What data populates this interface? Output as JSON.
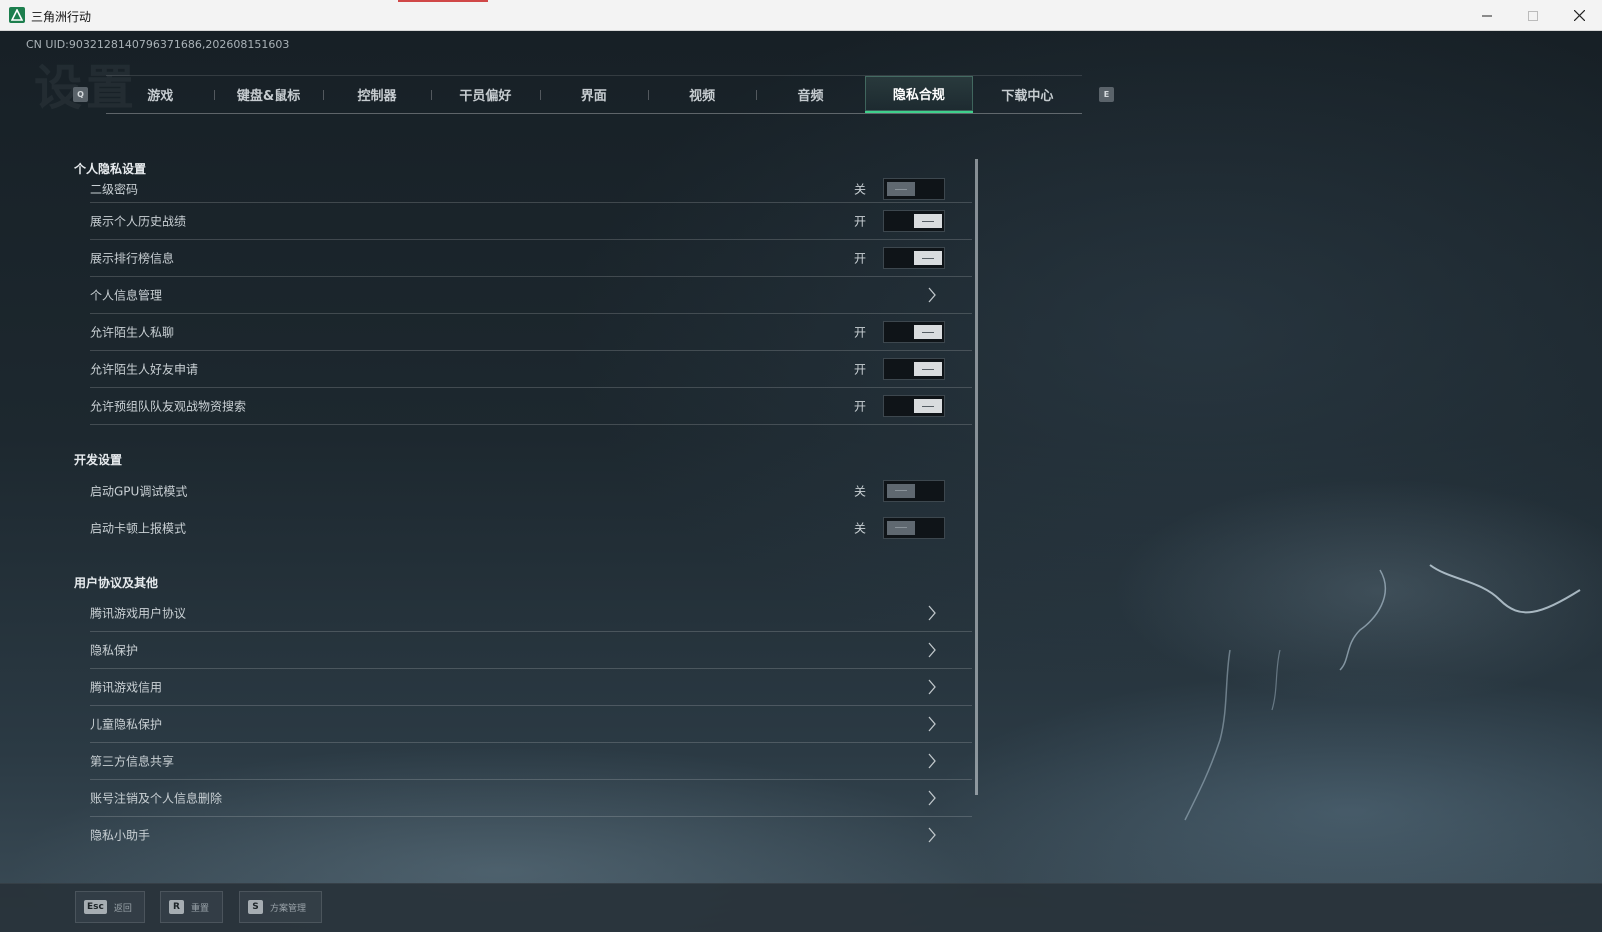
{
  "window": {
    "title": "三角洲行动"
  },
  "uid": "CN UID:9032128140796371686,202608151603",
  "watermark": "设置",
  "tabs": {
    "prev_key": "Q",
    "next_key": "E",
    "items": [
      {
        "label": "游戏",
        "active": false
      },
      {
        "label": "键盘&鼠标",
        "active": false
      },
      {
        "label": "控制器",
        "active": false
      },
      {
        "label": "干员偏好",
        "active": false
      },
      {
        "label": "界面",
        "active": false
      },
      {
        "label": "视频",
        "active": false
      },
      {
        "label": "音频",
        "active": false
      },
      {
        "label": "隐私合规",
        "active": true
      },
      {
        "label": "下载中心",
        "active": false
      }
    ]
  },
  "sections": {
    "privacy": {
      "title": "个人隐私设置",
      "rows": [
        {
          "label": "二级密码",
          "state": "关",
          "type": "toggle",
          "on": false
        },
        {
          "label": "展示个人历史战绩",
          "state": "开",
          "type": "toggle",
          "on": true
        },
        {
          "label": "展示排行榜信息",
          "state": "开",
          "type": "toggle",
          "on": true
        },
        {
          "label": "个人信息管理",
          "type": "link"
        },
        {
          "label": "允许陌生人私聊",
          "state": "开",
          "type": "toggle",
          "on": true
        },
        {
          "label": "允许陌生人好友申请",
          "state": "开",
          "type": "toggle",
          "on": true
        },
        {
          "label": "允许预组队队友观战物资搜索",
          "state": "开",
          "type": "toggle",
          "on": true
        }
      ]
    },
    "dev": {
      "title": "开发设置",
      "rows": [
        {
          "label": "启动GPU调试模式",
          "state": "关",
          "type": "toggle",
          "on": false
        },
        {
          "label": "启动卡顿上报模式",
          "state": "关",
          "type": "toggle",
          "on": false
        }
      ]
    },
    "agreements": {
      "title": "用户协议及其他",
      "rows": [
        {
          "label": "腾讯游戏用户协议",
          "type": "link"
        },
        {
          "label": "隐私保护",
          "type": "link"
        },
        {
          "label": "腾讯游戏信用",
          "type": "link"
        },
        {
          "label": "儿童隐私保护",
          "type": "link"
        },
        {
          "label": "第三方信息共享",
          "type": "link"
        },
        {
          "label": "账号注销及个人信息删除",
          "type": "link"
        },
        {
          "label": "隐私小助手",
          "type": "link"
        }
      ]
    }
  },
  "bottom": {
    "back": {
      "key": "Esc",
      "label": "返回"
    },
    "reset": {
      "key": "R",
      "label": "重置"
    },
    "scheme": {
      "key": "S",
      "label": "方案管理"
    }
  },
  "colors": {
    "accent": "#3fd08c",
    "app_icon": "#1d7f4e"
  }
}
